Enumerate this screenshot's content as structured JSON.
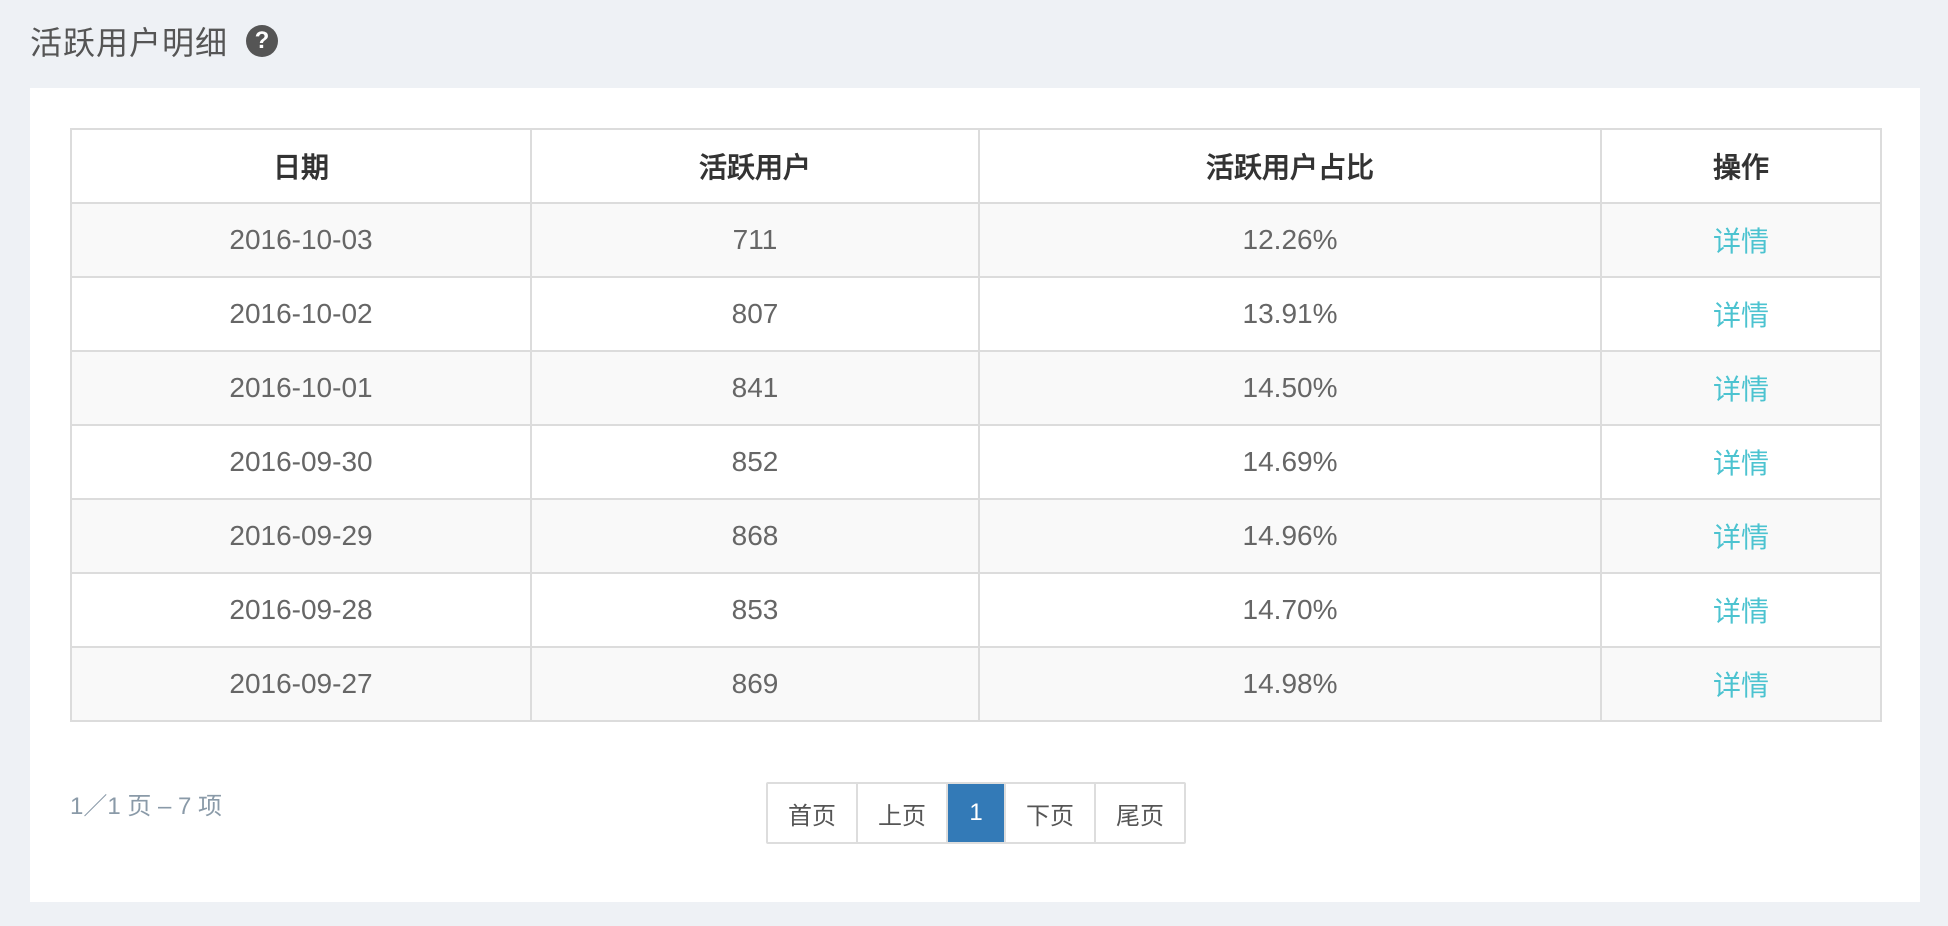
{
  "header": {
    "title": "活跃用户明细",
    "help_icon": "question-circle-icon"
  },
  "table": {
    "columns": [
      "日期",
      "活跃用户",
      "活跃用户占比",
      "操作"
    ],
    "rows": [
      {
        "date": "2016-10-03",
        "active_users": "711",
        "ratio": "12.26%",
        "action": "详情"
      },
      {
        "date": "2016-10-02",
        "active_users": "807",
        "ratio": "13.91%",
        "action": "详情"
      },
      {
        "date": "2016-10-01",
        "active_users": "841",
        "ratio": "14.50%",
        "action": "详情"
      },
      {
        "date": "2016-09-30",
        "active_users": "852",
        "ratio": "14.69%",
        "action": "详情"
      },
      {
        "date": "2016-09-29",
        "active_users": "868",
        "ratio": "14.96%",
        "action": "详情"
      },
      {
        "date": "2016-09-28",
        "active_users": "853",
        "ratio": "14.70%",
        "action": "详情"
      },
      {
        "date": "2016-09-27",
        "active_users": "869",
        "ratio": "14.98%",
        "action": "详情"
      }
    ]
  },
  "pagination": {
    "summary": "1／1 页 – 7 项",
    "first": "首页",
    "prev": "上页",
    "current": "1",
    "next": "下页",
    "last": "尾页"
  },
  "colors": {
    "link": "#4cc3d0",
    "active_page": "#337ab7",
    "background": "#eef1f5"
  }
}
